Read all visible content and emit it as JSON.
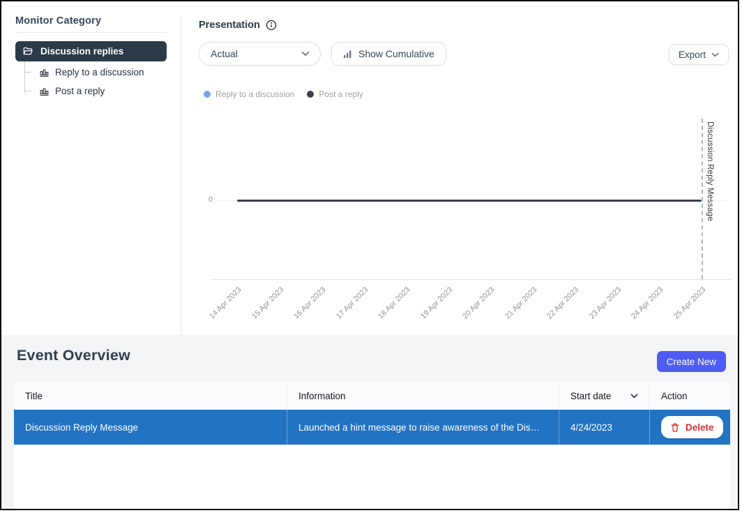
{
  "sidebar": {
    "title": "Monitor Category",
    "selected": {
      "label": "Discussion replies",
      "icon": "folder-icon"
    },
    "children": [
      {
        "label": "Reply to a discussion",
        "icon": "bar-chart-icon"
      },
      {
        "label": "Post a reply",
        "icon": "bar-chart-icon"
      }
    ]
  },
  "toolbar": {
    "title": "Presentation",
    "info_icon": "info-icon",
    "presentation_select_value": "Actual",
    "show_cumulative_label": "Show Cumulative",
    "export_label": "Export"
  },
  "chart_data": {
    "type": "line",
    "x": [
      "14 Apr 2023",
      "15 Apr 2023",
      "16 Apr 2023",
      "17 Apr 2023",
      "18 Apr 2023",
      "19 Apr 2023",
      "20 Apr 2023",
      "21 Apr 2023",
      "22 Apr 2023",
      "23 Apr 2023",
      "24 Apr 2023",
      "25 Apr 2023"
    ],
    "series": [
      {
        "name": "Reply to a discussion",
        "color": "#7aa3e9",
        "values": [
          0,
          0,
          0,
          0,
          0,
          0,
          0,
          0,
          0,
          0,
          0,
          0
        ]
      },
      {
        "name": "Post a reply",
        "color": "#3a4049",
        "values": [
          0,
          0,
          0,
          0,
          0,
          0,
          0,
          0,
          0,
          0,
          0,
          0
        ]
      }
    ],
    "y_ticks": [
      "0"
    ],
    "ylim": [
      0,
      null
    ],
    "grid": "zero-line-only",
    "legend_position": "top-left",
    "annotation": {
      "label": "Discussion Reply Message",
      "x": "25 Apr 2023",
      "style": "dashed-vertical-line"
    }
  },
  "events": {
    "title": "Event Overview",
    "create_button_label": "Create New",
    "table": {
      "columns": [
        {
          "label": "Title"
        },
        {
          "label": "Information"
        },
        {
          "label": "Start date",
          "sort": true
        },
        {
          "label": "Action"
        }
      ],
      "rows": [
        {
          "title": "Discussion Reply Message",
          "information": "Launched a hint message to raise awareness of the Dis…",
          "start_date": "4/24/2023",
          "action_label": "Delete",
          "selected": true
        }
      ]
    }
  },
  "colors": {
    "sidebar_selected_bg": "#2b3a49",
    "row_highlight": "#2273c3",
    "create_button": "#4d5df3",
    "delete_red": "#e02b2b",
    "section_bg": "#f4f5f6"
  }
}
